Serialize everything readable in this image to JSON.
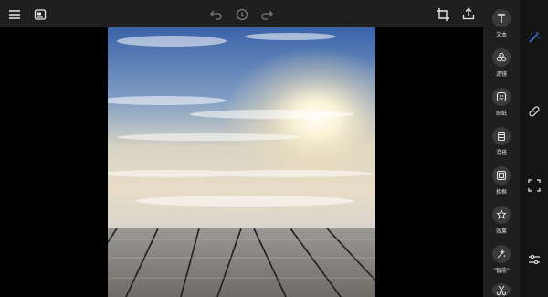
{
  "app": {
    "toolbar_icons": [
      "menu-icon",
      "save-image-icon",
      "undo-icon",
      "history-icon",
      "redo-icon",
      "crop-icon",
      "share-icon"
    ]
  },
  "tools": [
    {
      "name": "text",
      "label": "文本",
      "icon": "text-icon"
    },
    {
      "name": "filter",
      "label": "滤镜",
      "icon": "filter-icon"
    },
    {
      "name": "sticker",
      "label": "贴纸",
      "icon": "sticker-icon"
    },
    {
      "name": "blend",
      "label": "混搭",
      "icon": "blend-icon"
    },
    {
      "name": "frame",
      "label": "相框",
      "icon": "frame-icon"
    },
    {
      "name": "effect",
      "label": "效果",
      "icon": "star-icon"
    },
    {
      "name": "smart",
      "label": "\"智能\"",
      "icon": "smart-icon"
    },
    {
      "name": "more",
      "label": "",
      "icon": "scissors-icon"
    }
  ],
  "side_panel": {
    "icons": [
      "magic-wand-icon",
      "bandage-icon",
      "selection-icon",
      "adjust-sliders-icon"
    ],
    "active": "magic-wand-icon"
  },
  "colors": {
    "accent": "#3d8bfd",
    "toolbar_bg": "#1f1f1f",
    "panel_bg": "#141414"
  }
}
